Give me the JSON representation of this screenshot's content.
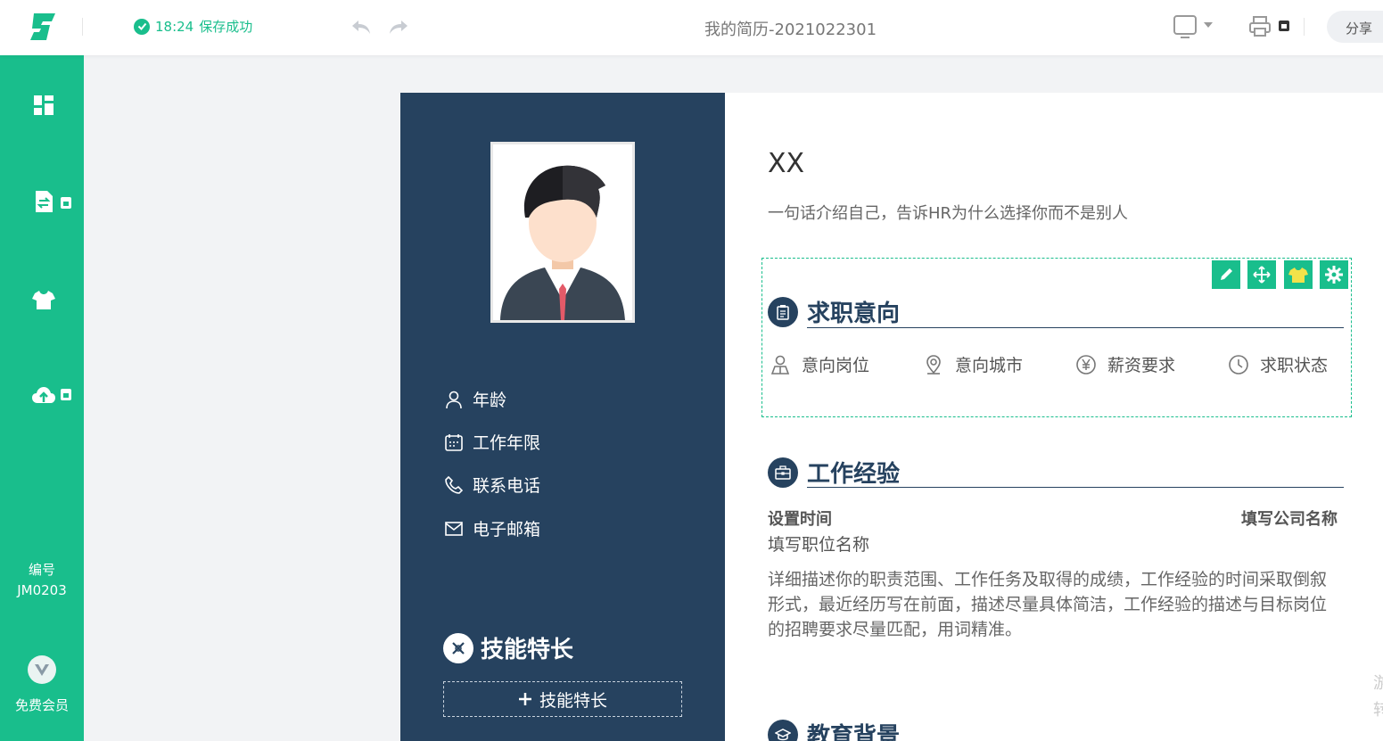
{
  "topbar": {
    "save_time": "18:24",
    "save_text": "保存成功",
    "doc_title": "我的简历-2021022301",
    "share_label": "分享"
  },
  "sidebar": {
    "code_label": "编号",
    "code_value": "JM0203",
    "vip_label": "免费会员"
  },
  "resume": {
    "name": "XX",
    "intro": "一句话介绍自己，告诉HR为什么选择你而不是别人",
    "info": [
      {
        "label": "年龄",
        "icon": "user-icon"
      },
      {
        "label": "工作年限",
        "icon": "calendar-icon"
      },
      {
        "label": "联系电话",
        "icon": "phone-icon"
      },
      {
        "label": "电子邮箱",
        "icon": "mail-icon"
      }
    ],
    "skills_title": "技能特长",
    "add_skill_label": "技能特长",
    "intent": {
      "title": "求职意向",
      "items": [
        {
          "label": "意向岗位",
          "icon": "person-icon"
        },
        {
          "label": "意向城市",
          "icon": "location-icon"
        },
        {
          "label": "薪资要求",
          "icon": "yen-icon"
        },
        {
          "label": "求职状态",
          "icon": "clock-icon"
        }
      ]
    },
    "experience": {
      "title": "工作经验",
      "date": "设置时间",
      "company": "填写公司名称",
      "position": "填写职位名称",
      "description": "详细描述你的职责范围、工作任务及取得的成绩，工作经验的时间采取倒叙形式，最近经历写在前面，描述尽量具体简洁，工作经验的描述与目标岗位的招聘要求尽量匹配，用词精准。"
    },
    "education": {
      "title": "教育背景"
    }
  },
  "edge_text": "游转",
  "colors": {
    "brand_green": "#19be8c",
    "navy": "#26425f"
  }
}
